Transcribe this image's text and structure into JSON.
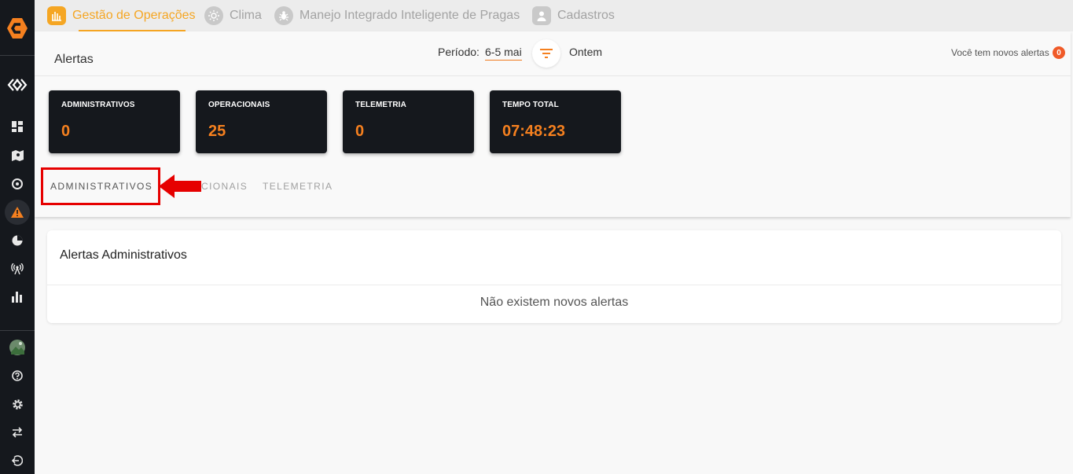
{
  "nav": {
    "tabs": [
      {
        "label": "Gestão de Operações",
        "icon": "chart-icon",
        "active": true
      },
      {
        "label": "Clima",
        "icon": "sun-icon",
        "active": false
      },
      {
        "label": "Manejo Integrado Inteligente de Pragas",
        "icon": "bug-icon",
        "active": false
      },
      {
        "label": "Cadastros",
        "icon": "person-icon",
        "active": false
      }
    ]
  },
  "header": {
    "title": "Alertas",
    "periodo_label": "Período:",
    "periodo_value": "6-5 mai",
    "ontem_label": "Ontem",
    "alerts_text": "Você tem novos alertas",
    "alerts_count": "0"
  },
  "stats": [
    {
      "label": "ADMINISTRATIVOS",
      "value": "0"
    },
    {
      "label": "OPERACIONAIS",
      "value": "25"
    },
    {
      "label": "TELEMETRIA",
      "value": "0"
    },
    {
      "label": "TEMPO TOTAL",
      "value": "07:48:23"
    }
  ],
  "tabs": [
    {
      "label": "ADMINISTRATIVOS",
      "active": true
    },
    {
      "label": "CIONAIS",
      "active": false
    },
    {
      "label": "TELEMETRIA",
      "active": false
    }
  ],
  "panel": {
    "title": "Alertas Administrativos",
    "empty_message": "Não existem novos alertas"
  },
  "colors": {
    "accent": "#f5a623",
    "value_orange": "#f5801f",
    "sidebar_bg": "#15181d",
    "highlight_red": "#e60000"
  }
}
